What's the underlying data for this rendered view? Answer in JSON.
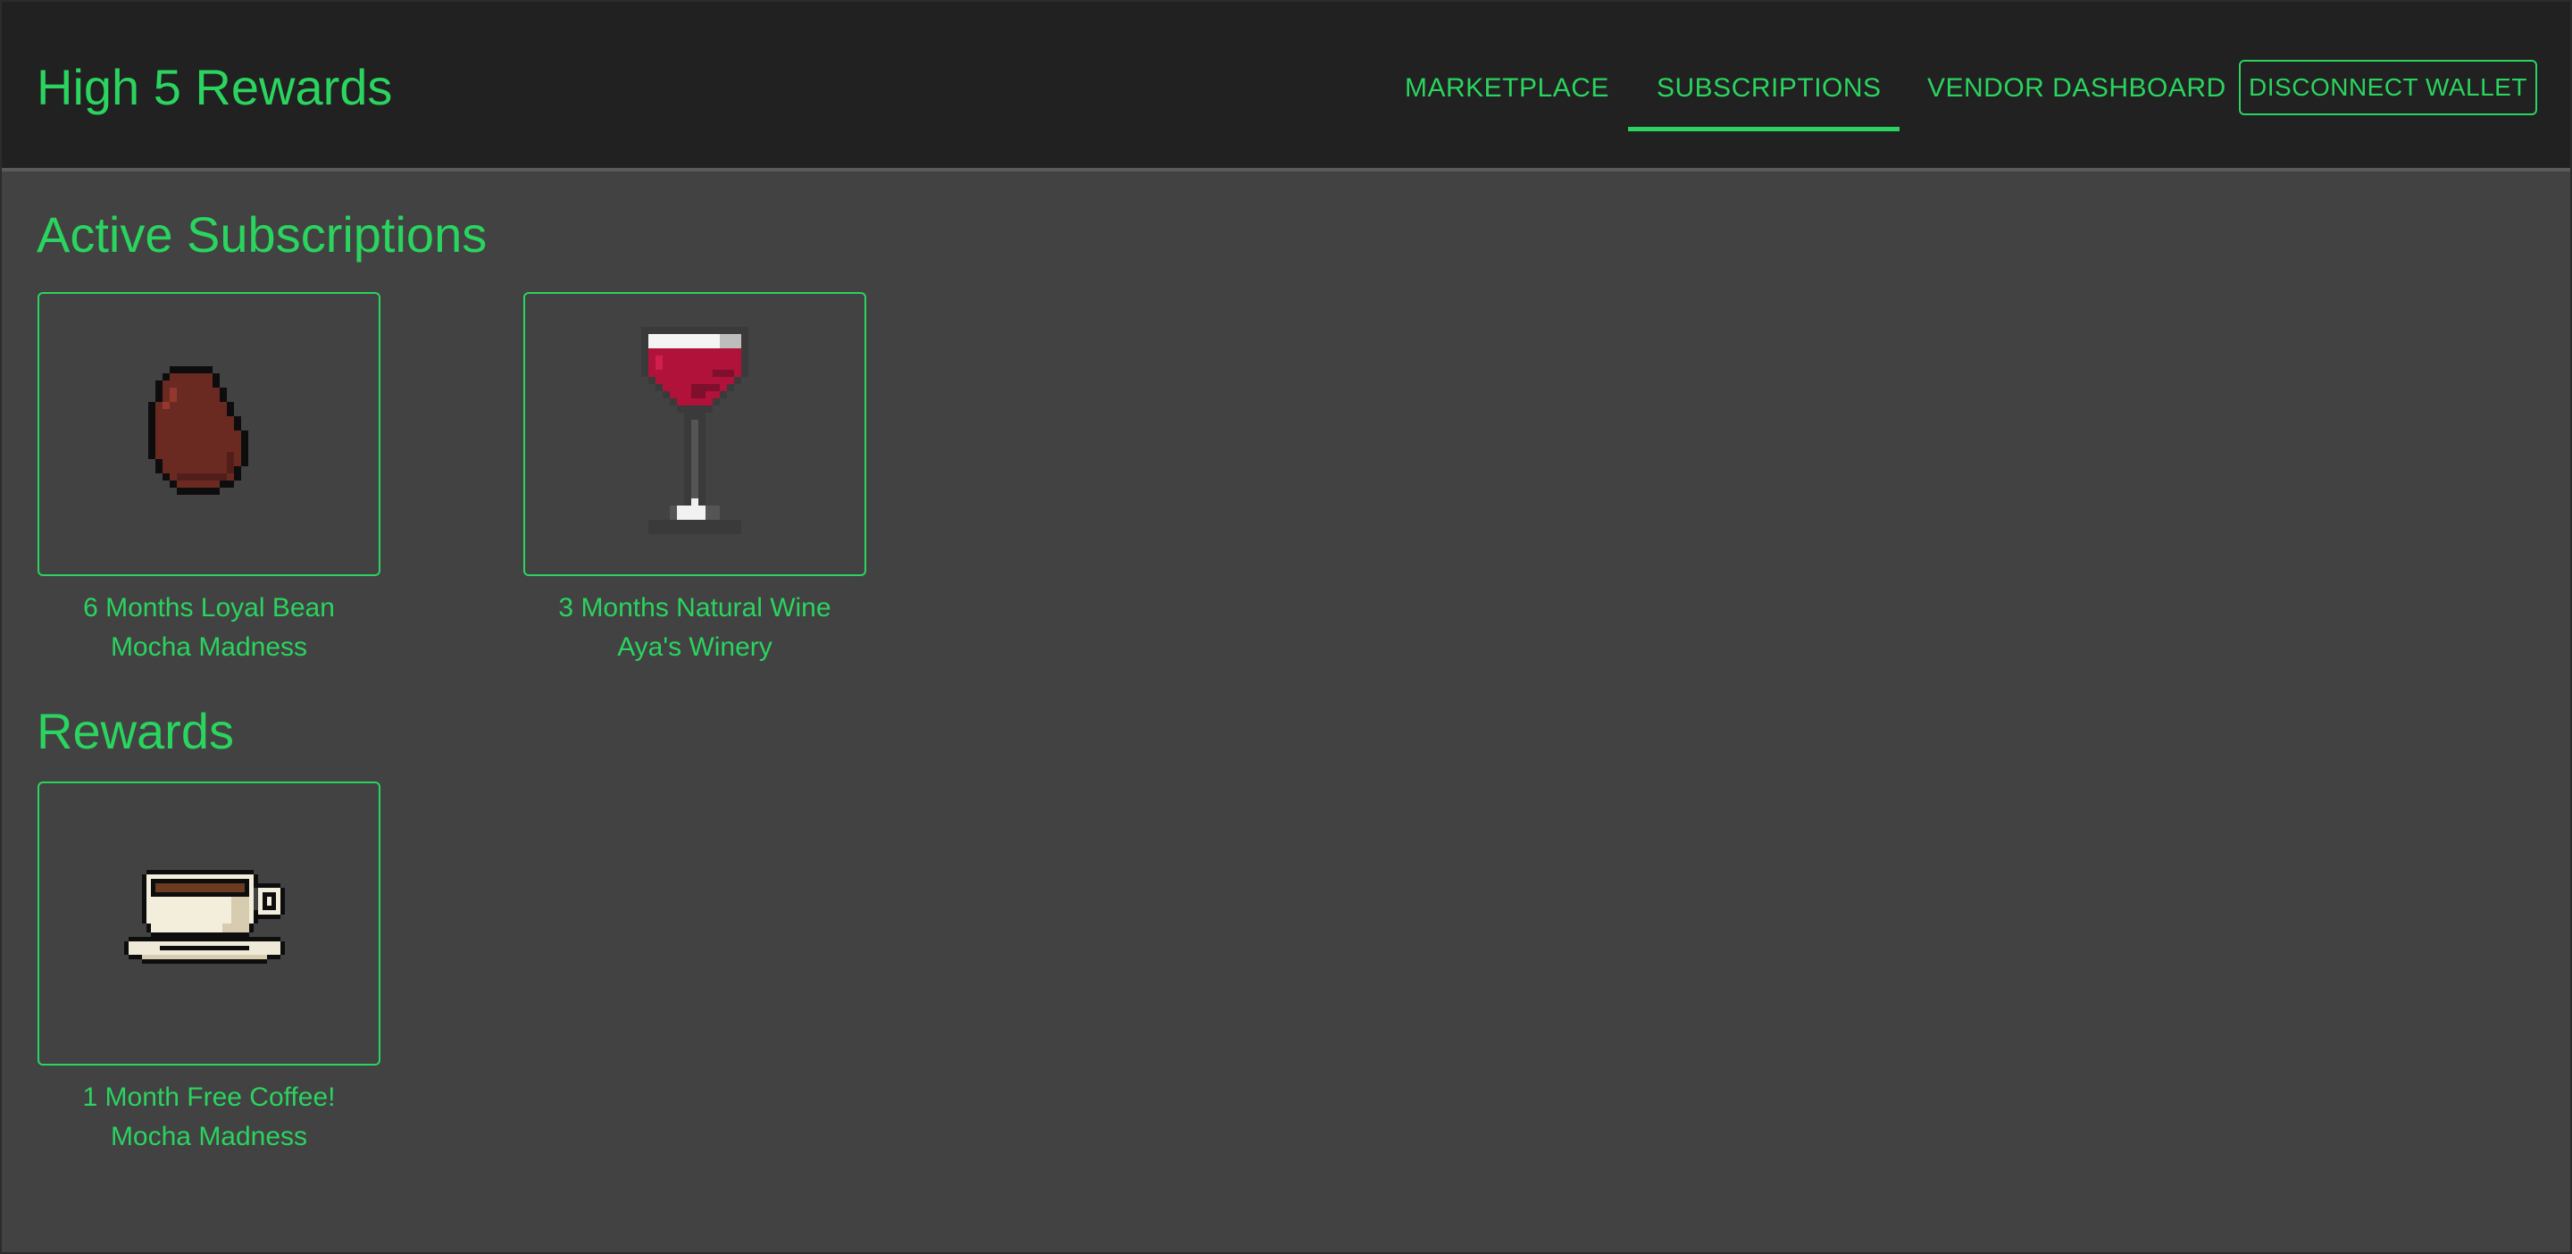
{
  "app": {
    "title": "High 5 Rewards"
  },
  "nav": {
    "links": [
      {
        "label": "MARKETPLACE"
      },
      {
        "label": "SUBSCRIPTIONS",
        "active": true
      },
      {
        "label": "VENDOR DASHBOARD"
      }
    ],
    "wallet_button": "DISCONNECT WALLET"
  },
  "sections": {
    "active_subscriptions": {
      "title": "Active Subscriptions",
      "items": [
        {
          "name": "6 Months Loyal Bean",
          "vendor": "Mocha Madness",
          "icon": "coffee-bean-icon"
        },
        {
          "name": "3 Months Natural Wine",
          "vendor": "Aya's Winery",
          "icon": "wine-glass-icon"
        }
      ]
    },
    "rewards": {
      "title": "Rewards",
      "items": [
        {
          "name": "1 Month Free Coffee!",
          "vendor": "Mocha Madness",
          "icon": "coffee-cup-icon"
        }
      ]
    }
  },
  "colors": {
    "accent": "#2ad45f",
    "appbar": "#212121",
    "background": "#424242"
  }
}
